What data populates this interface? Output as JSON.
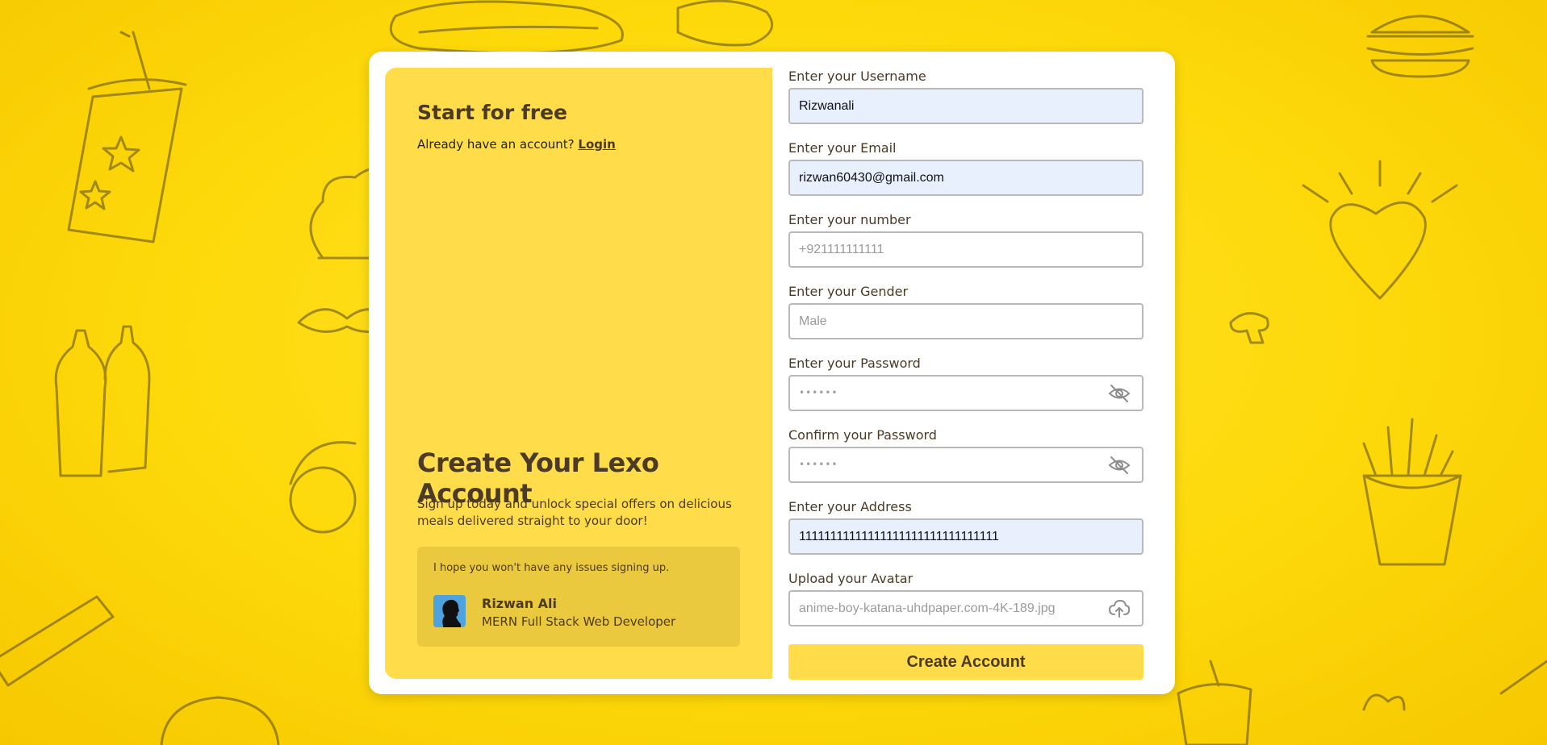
{
  "left_panel": {
    "start_title": "Start for free",
    "already_text": "Already have an account?",
    "login_link": "Login",
    "create_title": "Create Your Lexo Account",
    "create_desc": "Sign up today and unlock special offers on delicious meals delivered straight to your door!",
    "quote": "I hope you won't have any issues signing up.",
    "author_name": "Rizwan Ali",
    "author_role": "MERN Full Stack Web Developer"
  },
  "form": {
    "username": {
      "label": "Enter your Username",
      "value": "Rizwanali",
      "placeholder": ""
    },
    "email": {
      "label": "Enter your Email",
      "value": "rizwan60430@gmail.com",
      "placeholder": ""
    },
    "number": {
      "label": "Enter your number",
      "value": "",
      "placeholder": "+921111111111"
    },
    "gender": {
      "label": "Enter your Gender",
      "value": "",
      "placeholder": "Male"
    },
    "password": {
      "label": "Enter your Password",
      "masked": "••••••"
    },
    "confirm_password": {
      "label": "Confirm your Password",
      "masked": "••••••"
    },
    "address": {
      "label": "Enter your Address",
      "value": "11111111111111111111111111111111",
      "placeholder": ""
    },
    "avatar": {
      "label": "Upload your Avatar",
      "value": "",
      "placeholder": "anime-boy-katana-uhdpaper.com-4K-189.jpg"
    },
    "submit_label": "Create Account"
  },
  "colors": {
    "background_yellow": "#fdd90a",
    "panel_yellow": "#ffdc4a",
    "quote_box": "#ebc93e",
    "text_brown": "#4b3a26",
    "autofill_blue": "#e8f0fe"
  },
  "icons": {
    "password_toggle": "eye-slash-icon",
    "confirm_toggle": "eye-slash-icon",
    "upload": "cloud-upload-icon"
  }
}
